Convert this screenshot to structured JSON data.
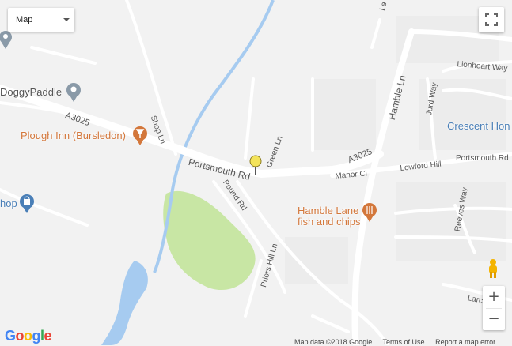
{
  "map_type": {
    "label": "Map"
  },
  "poi": {
    "doggy_paddle": "DoggyPaddle",
    "plough_inn": "Plough Inn (Bursledon)",
    "shop": "hop",
    "hamble_lane_line1": "Hamble Lane",
    "hamble_lane_line2": "fish and chips",
    "crescent": "Crescent Hon"
  },
  "roads": {
    "a3025_west": "A3025",
    "a3025_east": "A3025",
    "portsmouth_rd": "Portsmouth Rd",
    "portsmouth_rd_east": "Portsmouth Rd",
    "green_ln": "Green Ln",
    "shop_ln": "Shop Ln",
    "pound_rd": "Pound Rd",
    "priors_hill_ln": "Priors Hill Ln",
    "hamble_ln": "Hamble Ln",
    "manor_cl": "Manor Cl",
    "lowford_hill": "Lowford Hill",
    "jurd_way": "Jurd Way",
    "lionheart_way": "Lionheart Way",
    "reeves_way": "Reeves Way",
    "le_mare": "Le Mare",
    "larch": "Larc"
  },
  "zoom": {
    "in": "+",
    "out": "−"
  },
  "footer": {
    "map_data": "Map data ©2018 Google",
    "terms": "Terms of Use",
    "report": "Report a map error"
  },
  "google_logo": [
    "G",
    "o",
    "o",
    "g",
    "l",
    "e"
  ],
  "colors": {
    "water": "#a6cbf0",
    "park": "#c8e6a4",
    "road": "#ffffff",
    "poi_orange": "#d3773b",
    "poi_blue": "#4a7fb7",
    "marker": "#f3e35a"
  }
}
